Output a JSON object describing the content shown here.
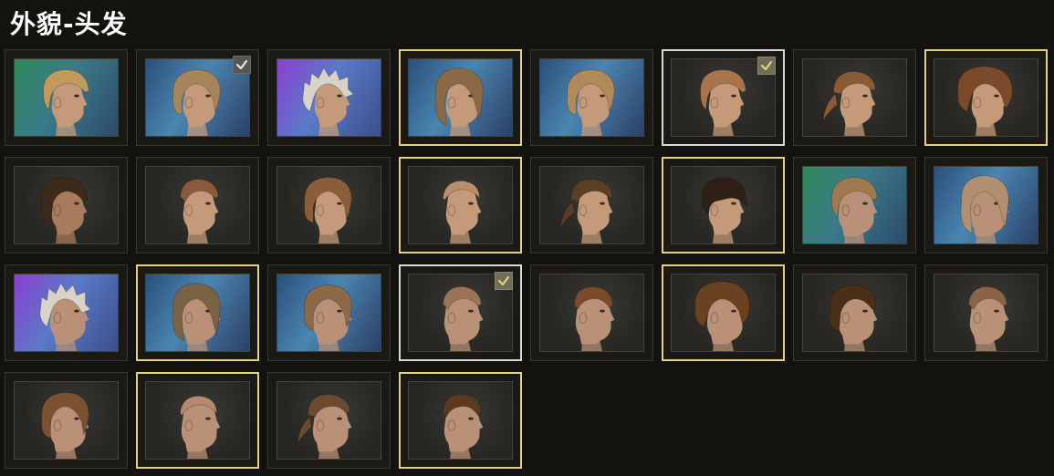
{
  "header": {
    "title": "外貌-头发"
  },
  "colors": {
    "gold_border": "#e6d27a",
    "selected_border": "#d8d8d8",
    "check_active": "#e6d27a",
    "check_inactive": "#e8e8e8"
  },
  "hair_options": [
    {
      "bg": "green",
      "skin": "#c59a7a",
      "hair": "#c29a5c",
      "style": "bob",
      "face": "female",
      "border": "normal",
      "check": "none"
    },
    {
      "bg": "blue",
      "skin": "#c59a7a",
      "hair": "#a78558",
      "style": "wavy",
      "face": "female",
      "border": "normal",
      "check": "grey"
    },
    {
      "bg": "purple",
      "skin": "#c59a7a",
      "hair": "#d8d2c8",
      "style": "messy",
      "face": "female",
      "border": "normal",
      "check": "none"
    },
    {
      "bg": "blue",
      "skin": "#c59a7a",
      "hair": "#8a6a44",
      "style": "long",
      "face": "female",
      "border": "gold",
      "check": "none"
    },
    {
      "bg": "blue",
      "skin": "#c59a7a",
      "hair": "#b08a58",
      "style": "wavy",
      "face": "female",
      "border": "normal",
      "check": "none"
    },
    {
      "bg": "dark",
      "skin": "#c59a7a",
      "hair": "#a8744a",
      "style": "bob",
      "face": "female",
      "border": "selected",
      "check": "gold"
    },
    {
      "bg": "dark",
      "skin": "#c59a7a",
      "hair": "#8a5a34",
      "style": "ponytail",
      "face": "female",
      "border": "normal",
      "check": "none"
    },
    {
      "bg": "dark",
      "skin": "#c59a7a",
      "hair": "#7a4a2a",
      "style": "afro",
      "face": "female",
      "border": "gold",
      "check": "none"
    },
    {
      "bg": "dark",
      "skin": "#a87a5e",
      "hair": "#3e2a1a",
      "style": "curly",
      "face": "female",
      "border": "normal",
      "check": "none"
    },
    {
      "bg": "dark",
      "skin": "#c59a7a",
      "hair": "#8a5a3a",
      "style": "undercut",
      "face": "female",
      "border": "normal",
      "check": "none"
    },
    {
      "bg": "dark",
      "skin": "#c59a7a",
      "hair": "#8a5e3a",
      "style": "wavy",
      "face": "female",
      "border": "normal",
      "check": "none"
    },
    {
      "bg": "dark",
      "skin": "#c59a7a",
      "hair": "#b88e6e",
      "style": "buzz",
      "face": "female",
      "border": "gold",
      "check": "none"
    },
    {
      "bg": "dark",
      "skin": "#c59a7a",
      "hair": "#5a3e26",
      "style": "ponytail",
      "face": "female",
      "border": "normal",
      "check": "none"
    },
    {
      "bg": "dark",
      "skin": "#c59a7a",
      "hair": "#2e2016",
      "style": "sidecut",
      "face": "female",
      "border": "gold",
      "check": "none"
    },
    {
      "bg": "green",
      "skin": "#b99078",
      "hair": "#a07a4e",
      "style": "bob",
      "face": "male",
      "border": "normal",
      "check": "none"
    },
    {
      "bg": "blue",
      "skin": "#b99078",
      "hair": "#b09070",
      "style": "long",
      "face": "male",
      "border": "normal",
      "check": "none"
    },
    {
      "bg": "purple",
      "skin": "#b99078",
      "hair": "#d8d2c8",
      "style": "messy",
      "face": "male",
      "border": "normal",
      "check": "none"
    },
    {
      "bg": "blue",
      "skin": "#b99078",
      "hair": "#7a6244",
      "style": "long",
      "face": "male",
      "border": "gold",
      "check": "none"
    },
    {
      "bg": "blue",
      "skin": "#b99078",
      "hair": "#8a6a48",
      "style": "wavy",
      "face": "male",
      "border": "normal",
      "check": "none"
    },
    {
      "bg": "dark",
      "skin": "#b99078",
      "hair": "#9a7458",
      "style": "undercut",
      "face": "male",
      "border": "selected",
      "check": "gold"
    },
    {
      "bg": "dark",
      "skin": "#b99078",
      "hair": "#7a4a2a",
      "style": "short",
      "face": "male",
      "border": "normal",
      "check": "none"
    },
    {
      "bg": "dark",
      "skin": "#b99078",
      "hair": "#6a4220",
      "style": "afro",
      "face": "male",
      "border": "gold",
      "check": "none"
    },
    {
      "bg": "dark",
      "skin": "#b99078",
      "hair": "#4a2e18",
      "style": "curly",
      "face": "male",
      "border": "normal",
      "check": "none"
    },
    {
      "bg": "dark",
      "skin": "#b99078",
      "hair": "#8a6448",
      "style": "undercut",
      "face": "male",
      "border": "normal",
      "check": "none"
    },
    {
      "bg": "dark",
      "skin": "#b99078",
      "hair": "#7a5232",
      "style": "wavy",
      "face": "male",
      "border": "normal",
      "check": "none"
    },
    {
      "bg": "dark",
      "skin": "#b99078",
      "hair": "#b58a6e",
      "style": "buzz",
      "face": "male",
      "border": "gold",
      "check": "none"
    },
    {
      "bg": "dark",
      "skin": "#b99078",
      "hair": "#6a4a30",
      "style": "ponytail",
      "face": "male",
      "border": "normal",
      "check": "none"
    },
    {
      "bg": "dark",
      "skin": "#b99078",
      "hair": "#5a3a20",
      "style": "short",
      "face": "male",
      "border": "gold",
      "check": "none"
    }
  ]
}
